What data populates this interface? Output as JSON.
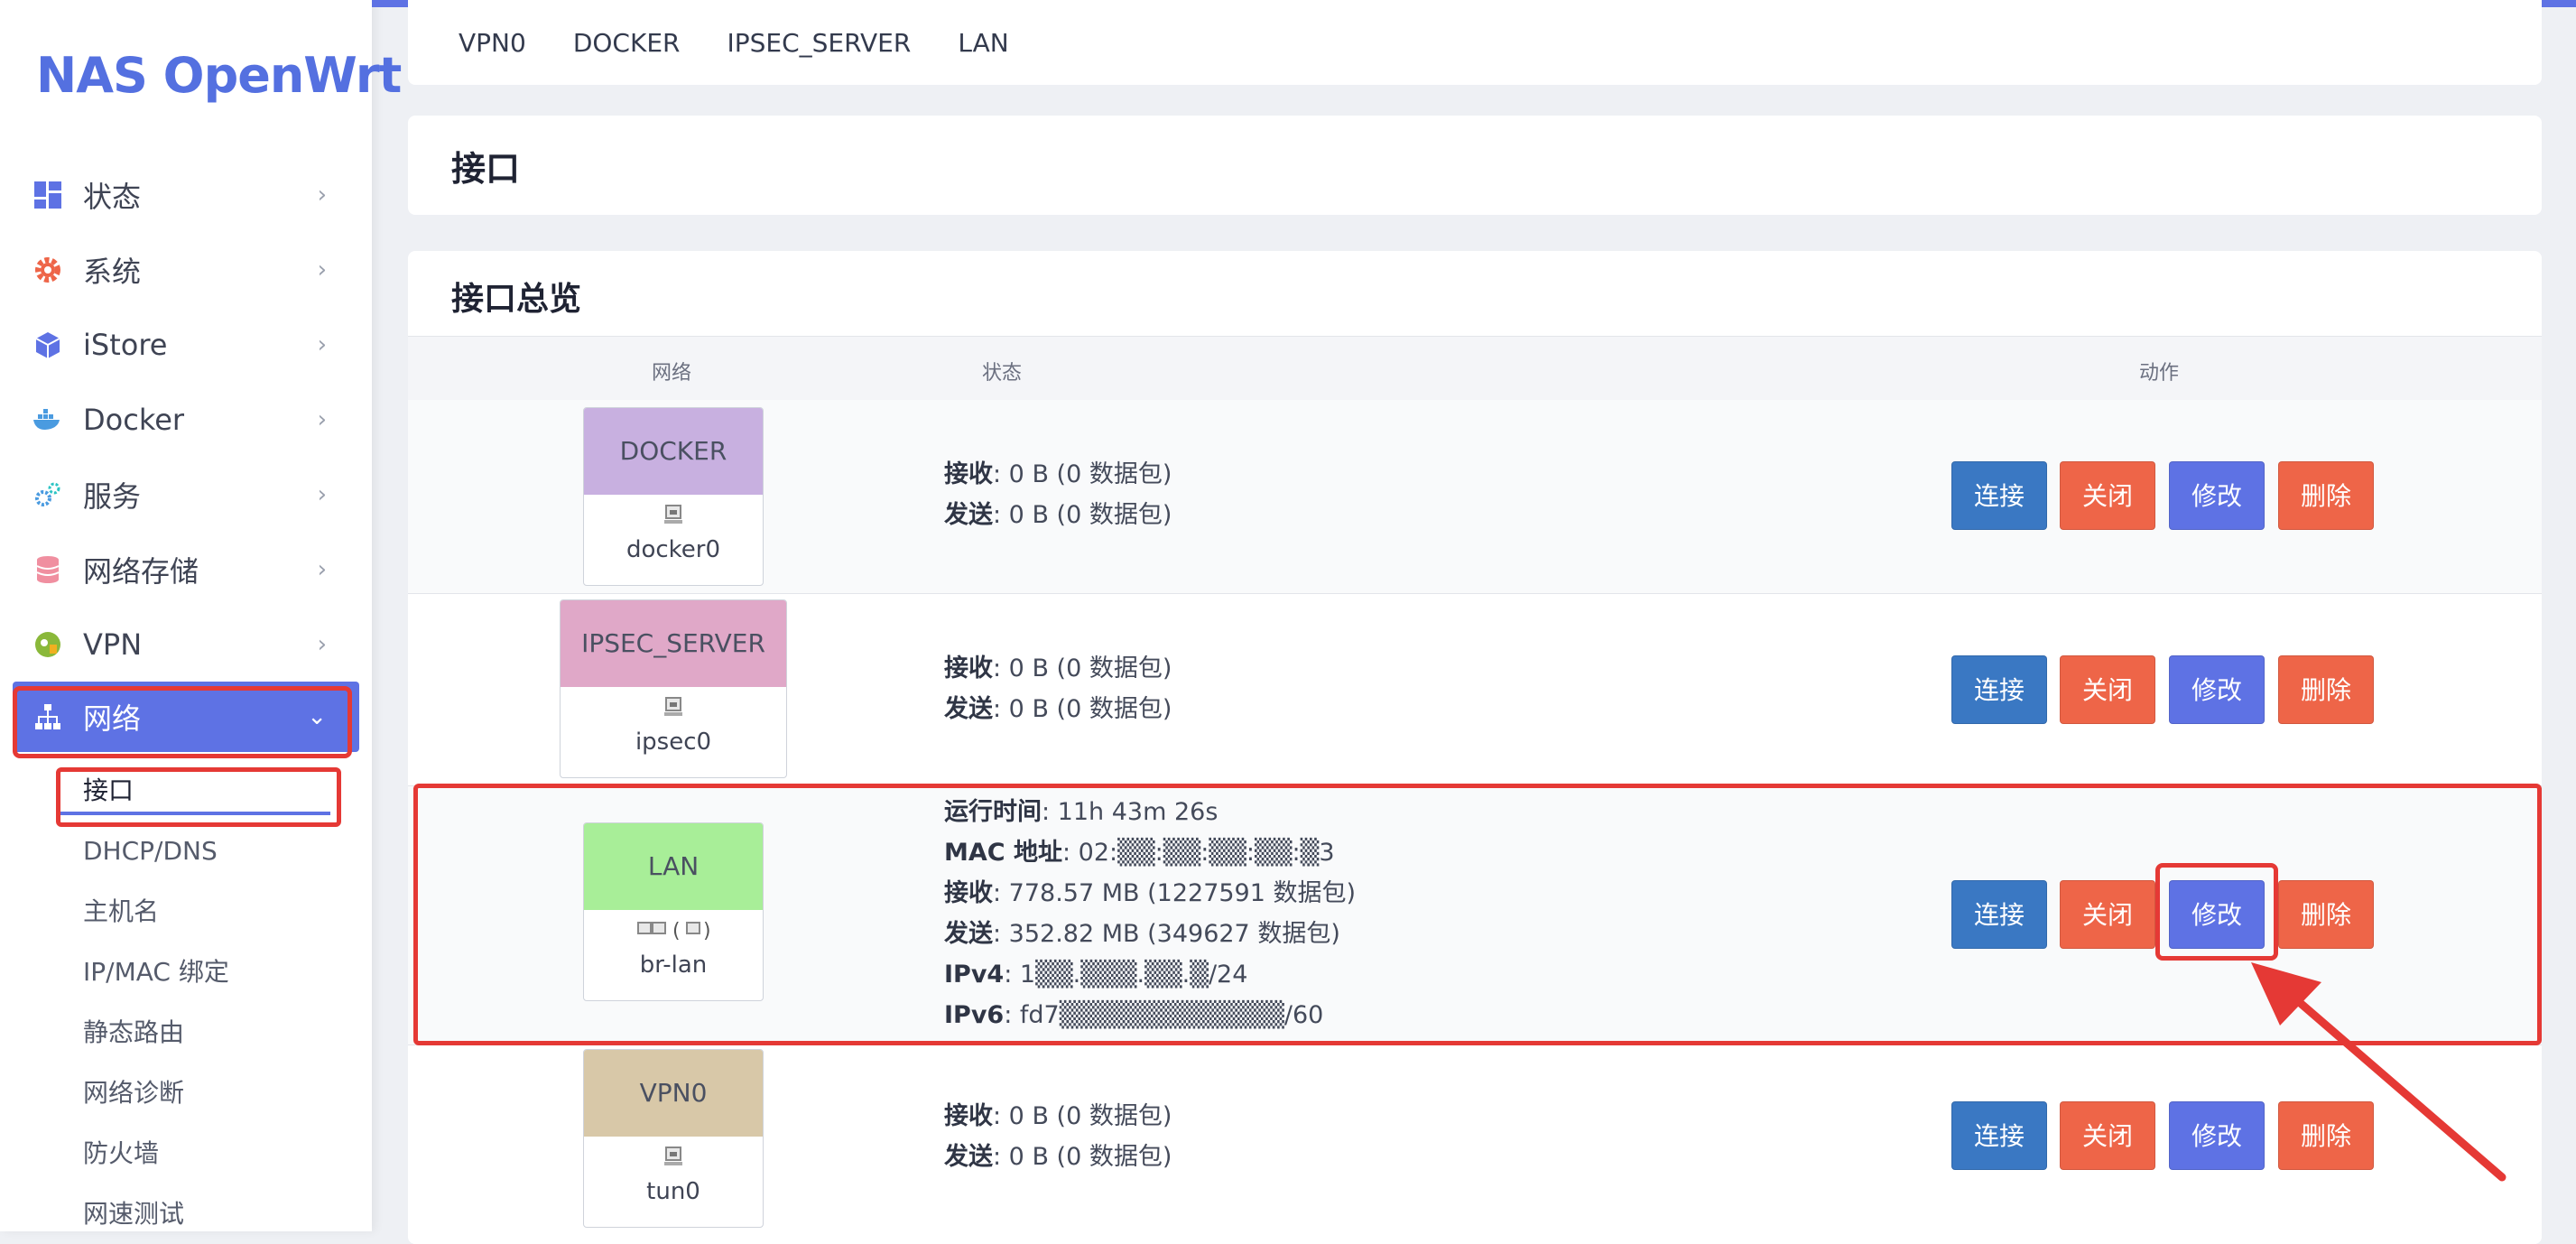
{
  "brand": "NAS OpenWrt",
  "sidebar": {
    "items": [
      {
        "label": "状态",
        "icon": "dashboard-icon"
      },
      {
        "label": "系统",
        "icon": "gear-icon"
      },
      {
        "label": "iStore",
        "icon": "box-icon"
      },
      {
        "label": "Docker",
        "icon": "docker-icon"
      },
      {
        "label": "服务",
        "icon": "services-icon"
      },
      {
        "label": "网络存储",
        "icon": "database-icon"
      },
      {
        "label": "VPN",
        "icon": "vpn-icon"
      },
      {
        "label": "网络",
        "icon": "network-icon"
      }
    ],
    "subitems": [
      "接口",
      "DHCP/DNS",
      "主机名",
      "IP/MAC 绑定",
      "静态路由",
      "网络诊断",
      "防火墙",
      "网速测试"
    ]
  },
  "tabs": [
    "VPN0",
    "DOCKER",
    "IPSEC_SERVER",
    "LAN"
  ],
  "page_title": "接口",
  "overview": {
    "title": "接口总览",
    "headers": {
      "network": "网络",
      "status": "状态",
      "actions": "动作"
    },
    "buttons": {
      "connect": "连接",
      "close": "关闭",
      "edit": "修改",
      "delete": "删除"
    },
    "rows": [
      {
        "name": "DOCKER",
        "device": "docker0",
        "color": "#c8b0e0",
        "lines": [
          {
            "k": "接收",
            "v": ": 0 B (0 数据包)"
          },
          {
            "k": "发送",
            "v": ": 0 B (0 数据包)"
          }
        ]
      },
      {
        "name": "IPSEC_SERVER",
        "device": "ipsec0",
        "color": "#e0a8c8",
        "lines": [
          {
            "k": "接收",
            "v": ": 0 B (0 数据包)"
          },
          {
            "k": "发送",
            "v": ": 0 B (0 数据包)"
          }
        ]
      },
      {
        "name": "LAN",
        "device": "br-lan",
        "color": "#a8ee98",
        "icon_text": "(",
        "lines": [
          {
            "k": "运行时间",
            "v": ": 11h 43m 26s"
          },
          {
            "k": "MAC 地址",
            "v": ": 02:▒▒:▒▒:▒▒:▒▒:▒3"
          },
          {
            "k": "接收",
            "v": ": 778.57 MB (1227591 数据包)"
          },
          {
            "k": "发送",
            "v": ": 352.82 MB (349627 数据包)"
          },
          {
            "k": "IPv4",
            "v": ": 1▒▒.▒▒▒.▒▒.▒/24"
          },
          {
            "k": "IPv6",
            "v": ": fd7▒▒▒▒▒▒▒▒▒▒▒▒/60"
          }
        ]
      },
      {
        "name": "VPN0",
        "device": "tun0",
        "color": "#d8c8a8",
        "lines": [
          {
            "k": "接收",
            "v": ": 0 B (0 数据包)"
          },
          {
            "k": "发送",
            "v": ": 0 B (0 数据包)"
          }
        ]
      }
    ]
  }
}
